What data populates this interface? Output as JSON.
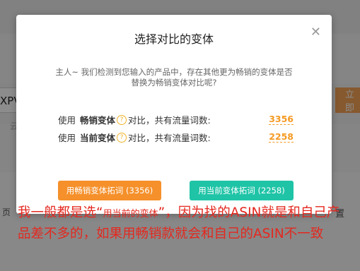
{
  "background": {
    "input_fragment": "XPV",
    "input_sub_fragment": "云",
    "button_fragment": "立即",
    "left_fragment": "页",
    "right_fragment": "置"
  },
  "modal": {
    "title": "选择对比的变体",
    "description": "主人~ 我们检测到您输入的产品中，存在其他更为畅销的变体是否替换为畅销变体对比呢?",
    "rows": [
      {
        "prefix": "使用",
        "bold": "畅销变体",
        "suffix": "对比，共有流量词数:",
        "value": "3356"
      },
      {
        "prefix": "使用",
        "bold": "当前变体",
        "suffix": "对比，共有流量词数:",
        "value": "2258"
      }
    ],
    "buttons": {
      "best_label": "用畅销变体拓词 (3356)",
      "current_label": "用当前变体拓词 (2258)"
    },
    "colors": {
      "orange": "#f5902a",
      "teal": "#1fc4a7"
    }
  },
  "annotation": {
    "part1": "我一般都是选“",
    "part2": "用当前的变体",
    "part3": "”，因为找的ASIN就是和自己产品差不多的，如果用畅销款就会和自己的ASIN不一致",
    "color": "#e4281f"
  }
}
